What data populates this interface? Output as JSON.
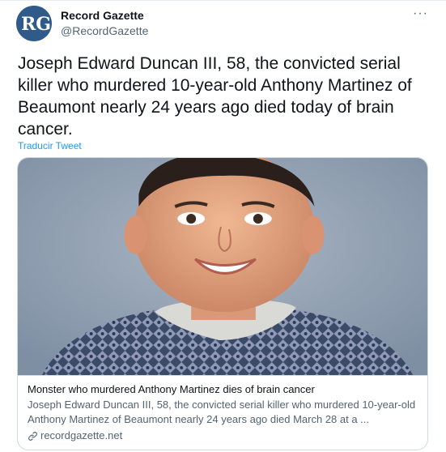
{
  "author": {
    "display_name": "Record Gazette",
    "handle": "@RecordGazette",
    "avatar_text": "RG"
  },
  "more_label": "···",
  "tweet": {
    "text": "Joseph Edward Duncan III, 58, the convicted serial killer who murdered 10-year-old Anthony Martinez of Beaumont nearly 24 years ago died today of brain cancer.",
    "translate_label": "Traducir Tweet"
  },
  "card": {
    "title": "Monster who murdered Anthony Martinez dies of brain cancer",
    "description": "Joseph Edward Duncan III, 58, the convicted serial killer who murdered 10-year-old Anthony Martinez of Beaumont nearly 24 years ago died March 28 at a ...",
    "domain": "recordgazette.net"
  },
  "colors": {
    "accent": "#1d9bf0",
    "secondary_text": "#536471",
    "primary_text": "#0f1419",
    "border": "#cfd9de"
  }
}
